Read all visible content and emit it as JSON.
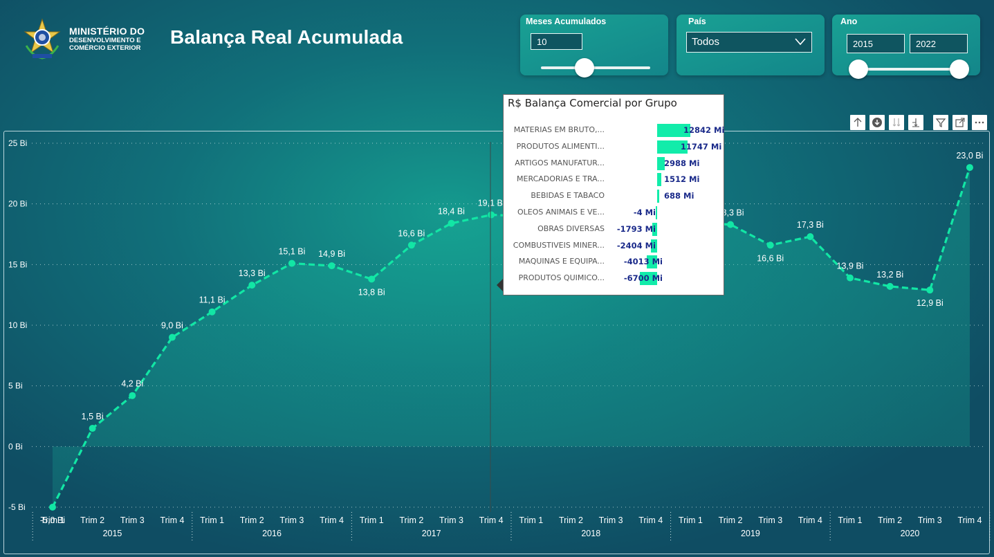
{
  "header": {
    "org_line1": "MINISTÉRIO DO",
    "org_line2": "DESENVOLVIMENTO E",
    "org_line3": "COMÉRCIO EXTERIOR",
    "title": "Balança Real Acumulada"
  },
  "slicers": {
    "meses": {
      "title": "Meses Acumulados",
      "value": "10",
      "position_fraction": 0.41
    },
    "pais": {
      "title": "País",
      "value": "Todos"
    },
    "ano": {
      "title": "Ano",
      "from": "2015",
      "to": "2022"
    }
  },
  "toolbar_icons": [
    "arrow-up-icon",
    "drill-down-icon",
    "expand-all-down-icon",
    "expand-next-level-icon",
    "filter-icon",
    "focus-mode-icon",
    "more-options-icon"
  ],
  "colors": {
    "line": "#12e6a5",
    "bar": "#12ecaa",
    "tooltip_value": "#1a2a8a"
  },
  "chart_data": {
    "type": "line",
    "title": "",
    "ylim": [
      -5,
      25
    ],
    "yticks": [
      "-5 Bi",
      "0 Bi",
      "5 Bi",
      "10 Bi",
      "15 Bi",
      "20 Bi",
      "25 Bi"
    ],
    "ytick_values": [
      -5,
      0,
      5,
      10,
      15,
      20,
      25
    ],
    "grid": true,
    "years": [
      "2015",
      "2016",
      "2017",
      "2018",
      "2019",
      "2020"
    ],
    "quarters": [
      "Trim 1",
      "Trim 2",
      "Trim 3",
      "Trim 4"
    ],
    "series": [
      {
        "values": [
          -5.0,
          1.5,
          4.2,
          9.0,
          11.1,
          13.3,
          15.1,
          14.9,
          13.8,
          16.6,
          18.4,
          19.1,
          null,
          null,
          null,
          null,
          null,
          18.3,
          16.6,
          17.3,
          13.9,
          13.2,
          12.9,
          23.0
        ],
        "labels": [
          "-5,0 Bi",
          "1,5 Bi",
          "4,2 Bi",
          "9,0 Bi",
          "11,1 Bi",
          "13,3 Bi",
          "15,1 Bi",
          "14,9 Bi",
          "13,8 Bi",
          "16,6 Bi",
          "18,4 Bi",
          "19,1 Bi",
          "",
          "",
          "",
          "",
          "",
          "18,3 Bi",
          "16,6 Bi",
          "17,3 Bi",
          "13,9 Bi",
          "13,2 Bi",
          "12,9 Bi",
          "23,0 Bi"
        ]
      }
    ]
  },
  "tooltip": {
    "title": "R$ Balança Comercial por Grupo",
    "rows": [
      {
        "category": "MATERIAS EM BRUTO,...",
        "value": 12842,
        "label": "12842 Mi"
      },
      {
        "category": "PRODUTOS ALIMENTI...",
        "value": 11747,
        "label": "11747 Mi"
      },
      {
        "category": "ARTIGOS MANUFATUR...",
        "value": 2988,
        "label": "2988 Mi"
      },
      {
        "category": "MERCADORIAS E TRA...",
        "value": 1512,
        "label": "1512 Mi"
      },
      {
        "category": "BEBIDAS E TABACO",
        "value": 688,
        "label": "688 Mi"
      },
      {
        "category": "OLEOS ANIMAIS E VE...",
        "value": -4,
        "label": "-4 Mi"
      },
      {
        "category": "OBRAS DIVERSAS",
        "value": -1793,
        "label": "-1793 Mi"
      },
      {
        "category": "COMBUSTIVEIS MINER...",
        "value": -2404,
        "label": "-2404 Mi"
      },
      {
        "category": "MAQUINAS E EQUIPA...",
        "value": -4013,
        "label": "-4013 Mi"
      },
      {
        "category": "PRODUTOS QUIMICO...",
        "value": -6700,
        "label": "-6700 Mi"
      }
    ]
  }
}
